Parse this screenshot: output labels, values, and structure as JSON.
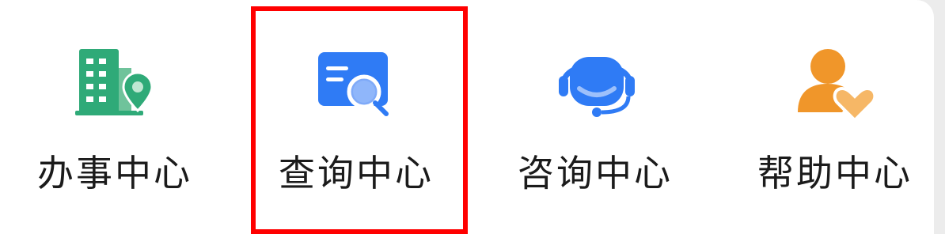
{
  "menu": {
    "items": [
      {
        "label": "办事中心",
        "icon": "office-building-location-icon",
        "color": "#2faa78"
      },
      {
        "label": "查询中心",
        "icon": "search-card-icon",
        "color": "#2f7bf5"
      },
      {
        "label": "咨询中心",
        "icon": "customer-service-headset-icon",
        "color": "#2f7bf5"
      },
      {
        "label": "帮助中心",
        "icon": "user-heart-help-icon",
        "color": "#f0962a"
      }
    ],
    "highlighted_index": 1,
    "highlight_color": "#ff0000"
  }
}
